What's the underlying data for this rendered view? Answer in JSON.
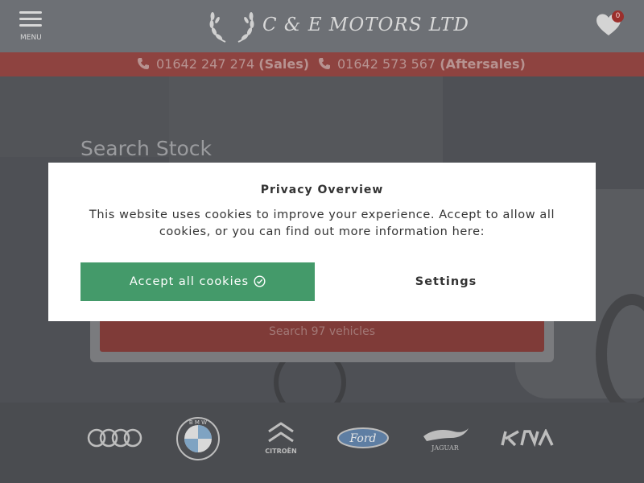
{
  "header": {
    "menu_label": "MENU",
    "logo_text": "C & E MOTORS LTD",
    "favourites_count": "0"
  },
  "phones": [
    {
      "number": "01642 247 274",
      "label": "(Sales)"
    },
    {
      "number": "01642 573 567",
      "label": "(Aftersales)"
    }
  ],
  "hero": {
    "search_title": "Search Stock",
    "search_button": "Search 97 vehicles"
  },
  "brands": [
    "Audi",
    "BMW",
    "CITROËN",
    "Ford",
    "JAGUAR",
    "KIA"
  ],
  "cookie_modal": {
    "title": "Privacy Overview",
    "text": "This website uses cookies to improve your experience. Accept to allow all cookies, or you can find out more information here:",
    "accept_label": "Accept all cookies",
    "settings_label": "Settings"
  },
  "colors": {
    "header_bg": "#6d7075",
    "phone_bar_bg": "#8e4340",
    "accept_green": "#449a6a",
    "badge_red": "#9b2f2c"
  },
  "icons": [
    "hamburger-menu-icon",
    "heart-icon",
    "phone-icon",
    "check-circle-icon",
    "laurel-wreath-icon"
  ]
}
